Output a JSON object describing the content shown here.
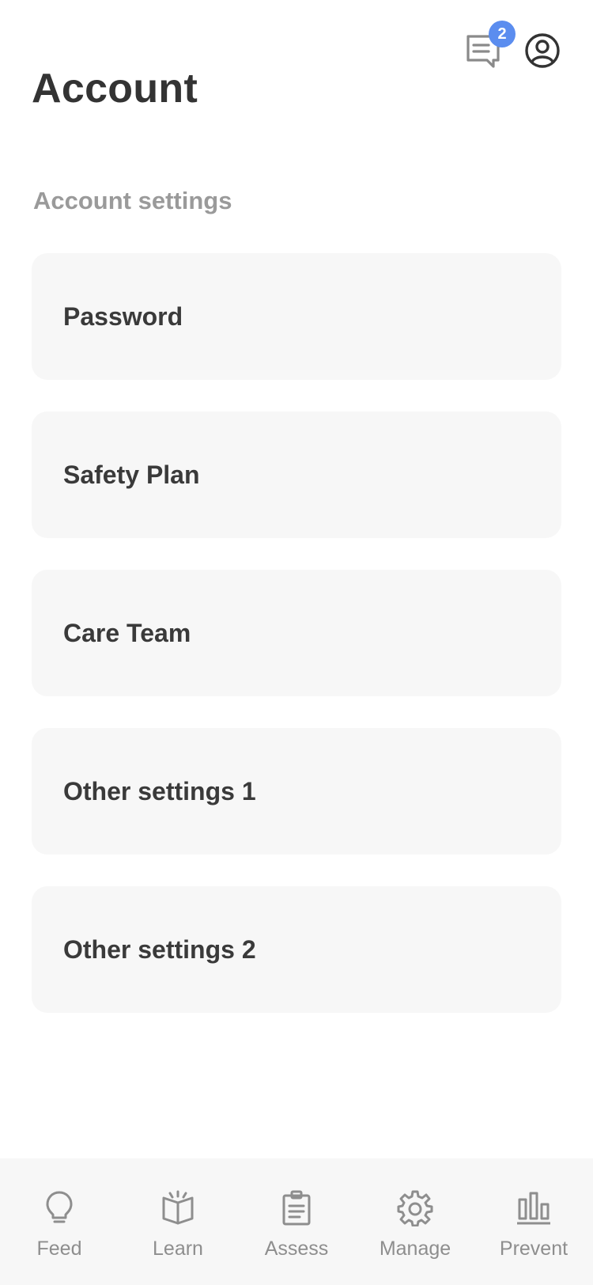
{
  "header": {
    "title": "Account",
    "messages_badge": "2",
    "messages_icon": "chat-icon",
    "profile_icon": "user-circle-icon"
  },
  "section": {
    "title": "Account settings"
  },
  "settings": {
    "items": [
      {
        "label": "Password"
      },
      {
        "label": "Safety Plan"
      },
      {
        "label": "Care Team"
      },
      {
        "label": "Other settings 1"
      },
      {
        "label": "Other settings 2"
      }
    ]
  },
  "nav": {
    "items": [
      {
        "label": "Feed",
        "icon": "lightbulb-icon"
      },
      {
        "label": "Learn",
        "icon": "open-book-icon"
      },
      {
        "label": "Assess",
        "icon": "clipboard-icon"
      },
      {
        "label": "Manage",
        "icon": "gear-icon"
      },
      {
        "label": "Prevent",
        "icon": "bar-chart-icon"
      }
    ]
  },
  "colors": {
    "badge": "#5b8def",
    "card_background": "#f7f7f7",
    "section_title": "#9a9a9a"
  }
}
